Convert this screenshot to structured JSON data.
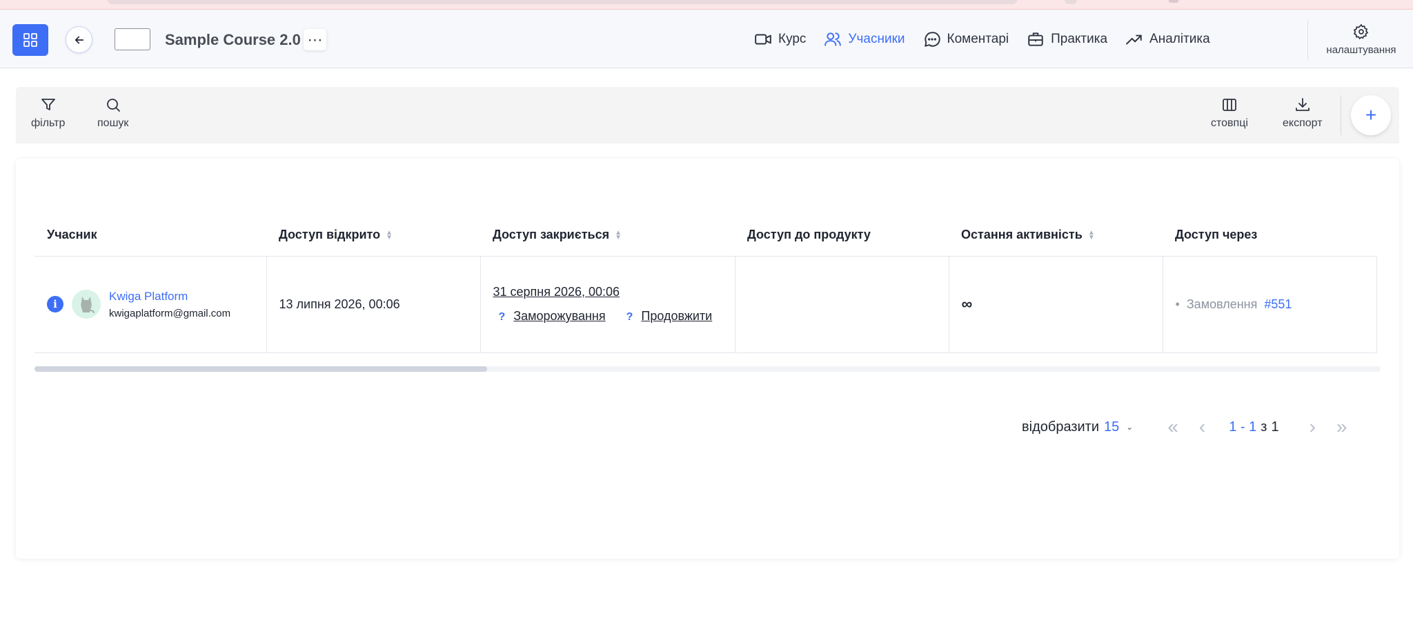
{
  "header": {
    "course_title": "Sample Course 2.0",
    "more_label": "⋯",
    "nav": [
      {
        "label": "Курс",
        "icon": "video-icon",
        "active": false
      },
      {
        "label": "Учасники",
        "icon": "users-icon",
        "active": true
      },
      {
        "label": "Коментарі",
        "icon": "comment-icon",
        "active": false
      },
      {
        "label": "Практика",
        "icon": "briefcase-icon",
        "active": false
      },
      {
        "label": "Аналітика",
        "icon": "trending-up-icon",
        "active": false
      }
    ],
    "settings_label": "налаштування"
  },
  "toolbar": {
    "filter_label": "фільтр",
    "search_label": "пошук",
    "columns_label": "стовпці",
    "export_label": "експорт",
    "add_label": "+"
  },
  "table": {
    "headers": [
      "Учасник",
      "Доступ відкрито",
      "Доступ закриється",
      "Доступ до продукту",
      "Остання активність",
      "Доступ через"
    ],
    "rows": [
      {
        "name": "Kwiga Platform",
        "email": "kwigaplatform@gmail.com",
        "access_opened": "13 липня 2026, 00:06",
        "access_closes": "31 серпня 2026, 00:06",
        "freeze_label": "Заморожування",
        "extend_label": "Продовжити",
        "help_mark": "?",
        "product_access": "",
        "last_activity": "∞",
        "access_via_label": "Замовлення",
        "access_via_number": "#551"
      }
    ]
  },
  "pagination": {
    "show_label": "відобразити",
    "per_page": "15",
    "range": "1 - 1",
    "of_label": "з",
    "total": "1"
  },
  "colors": {
    "accent": "#3d6ef5",
    "header_bg": "#f7f8fc",
    "toolbar_bg": "#f4f4f4"
  }
}
